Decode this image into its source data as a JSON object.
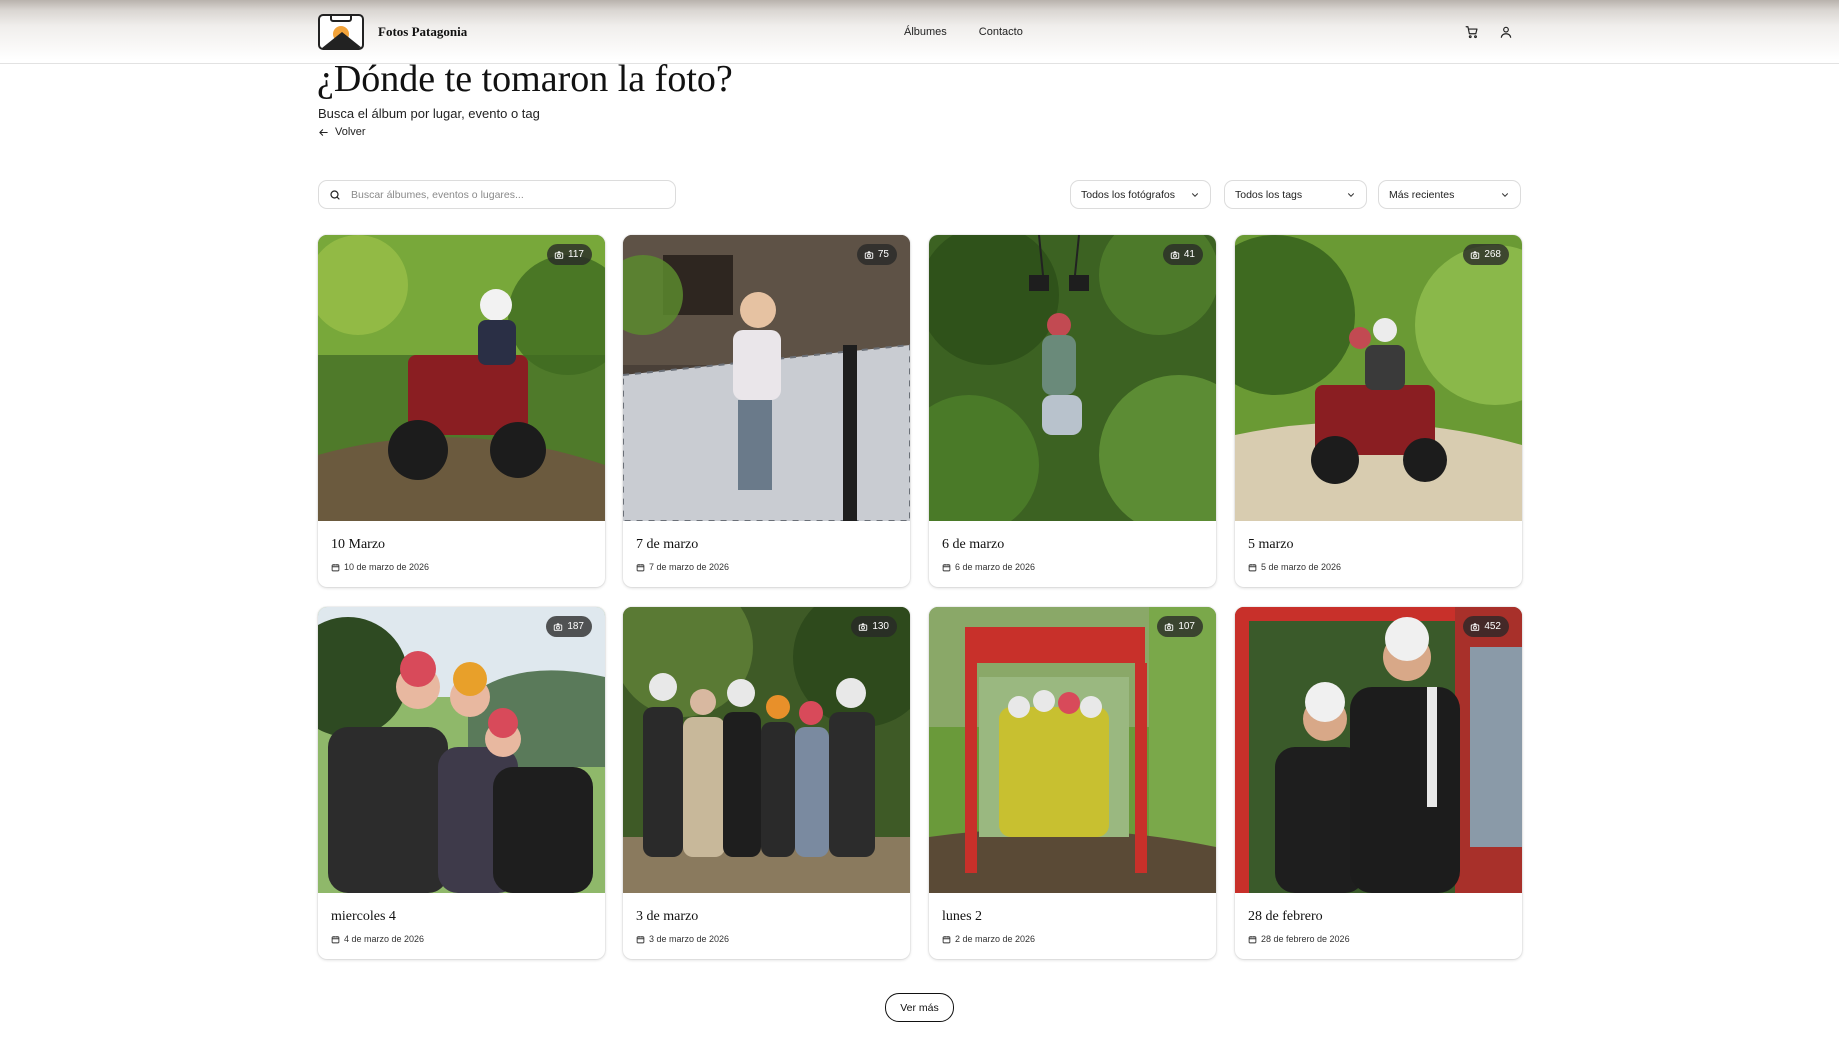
{
  "header": {
    "brand": "Fotos Patagonia",
    "nav": {
      "albums": "Álbumes",
      "contact": "Contacto"
    },
    "icons": [
      "cart-icon",
      "user-icon"
    ]
  },
  "page": {
    "title": "¿Dónde te tomaron la foto?",
    "subtitle": "Busca el álbum por lugar, evento o tag",
    "back_label": "Volver"
  },
  "filters": {
    "search_placeholder": "Buscar álbumes, eventos o lugares...",
    "photographer": "Todos los fotógrafos",
    "tags": "Todos los tags",
    "sort": "Más recientes"
  },
  "albums": [
    {
      "name": "10 Marzo",
      "date": "10 de marzo de 2026",
      "count": "117"
    },
    {
      "name": "7 de marzo",
      "date": "7 de marzo de 2026",
      "count": "75"
    },
    {
      "name": "6 de marzo",
      "date": "6 de marzo de 2026",
      "count": "41"
    },
    {
      "name": "5 marzo",
      "date": "5 de marzo de 2026",
      "count": "268"
    },
    {
      "name": "miercoles 4",
      "date": "4 de marzo de 2026",
      "count": "187"
    },
    {
      "name": "3 de marzo",
      "date": "3 de marzo de 2026",
      "count": "130"
    },
    {
      "name": "lunes 2",
      "date": "2 de marzo de 2026",
      "count": "107"
    },
    {
      "name": "28 de febrero",
      "date": "28 de febrero de 2026",
      "count": "452"
    }
  ],
  "load_more": "Ver más",
  "colors": {
    "accent_sun": "#f2a33a",
    "text": "#111111",
    "border": "#dcdcdc",
    "badge_bg": "#282828"
  }
}
